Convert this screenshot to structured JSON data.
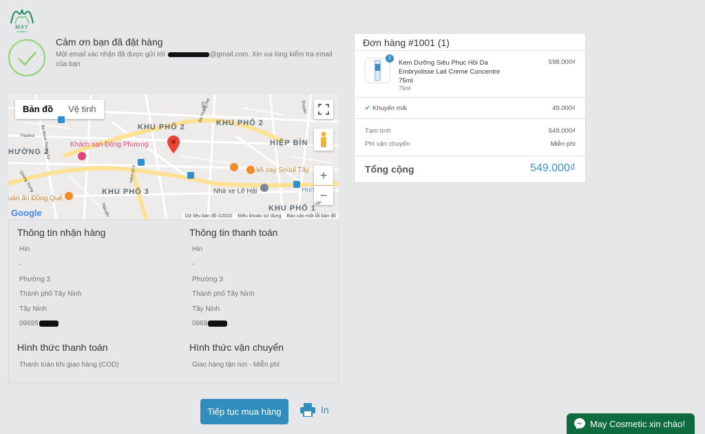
{
  "logo": {
    "brand": "MAY",
    "sub": "COSMETIC"
  },
  "thanks": {
    "title": "Cảm ơn bạn đã đặt hàng",
    "text_before": "Một email xác nhận đã được gửi tới ",
    "text_after": "@gmail.com. Xin vui lòng kiểm tra email của bạn"
  },
  "map": {
    "tabs": [
      "Bản đồ",
      "Vệ tinh"
    ],
    "areas": [
      "KHU PHỐ 2",
      "KHU PHỐ 2",
      "KHU PHỐ 3",
      "KHU PHỐ 1",
      "HIỆP BÌN",
      "HƯỜNG 2"
    ],
    "places": {
      "hotel": "Khách sạn Đông Phương",
      "noodle": "Mì cay Seoul Tây",
      "garage": "Nhà xe Lê Hải",
      "restaurant": "uán ăn Đồng Quê",
      "hon": "Hon"
    },
    "streets": [
      "Ba Mươi Tháng Tư",
      "Ba Tháng Hai",
      "Pasteur",
      "Quang Trung",
      "Hẻm số 0",
      "Nguyễn",
      "Thuyền",
      "Vân",
      "Trần"
    ],
    "footer": [
      "Dữ liệu bản đồ ©2020",
      "Điều khoản sử dụng",
      "Báo cáo một lỗi bản đồ"
    ],
    "google": "Google",
    "zoom_in": "+",
    "zoom_out": "−"
  },
  "shipping_info": {
    "title": "Thông tin nhận hàng",
    "name": "Hin",
    "address": "-",
    "ward": "Phường 3",
    "city": "Thành phố Tây Ninh",
    "province": "Tây Ninh",
    "phone_prefix": "09695"
  },
  "billing_info": {
    "title": "Thông tin thanh toán",
    "name": "Hin",
    "address": "-",
    "ward": "Phường 3",
    "city": "Thành phố Tây Ninh",
    "province": "Tây Ninh",
    "phone_prefix": "0969"
  },
  "payment_method": {
    "title": "Hình thức thanh toán",
    "value": "Thanh toán khi giao hàng (COD)"
  },
  "shipping_method": {
    "title": "Hình thức vận chuyển",
    "value": "Giao hàng tận nơi - Miễn phí"
  },
  "actions": {
    "continue": "Tiếp tục mua hàng",
    "print": "In"
  },
  "order": {
    "title": "Đơn hàng #1001 (1)",
    "product": {
      "name": "Kem Dưỡng Siêu Phục Hồi Da Embryolisse Lait Creme Concentre 75ml",
      "variant": "75ml",
      "price": "598.000₫",
      "quantity": "1"
    },
    "discount_label": "Khuyến mãi",
    "discount_value": "49.000₫",
    "subtotal_label": "Tạm tính",
    "subtotal_value": "549.000₫",
    "shipping_label": "Phí vận chuyển",
    "shipping_value": "Miễn phí",
    "total_label": "Tổng cộng",
    "total_value": "549.000₫"
  },
  "chat": {
    "label": "May Cosmetic xin chào!"
  },
  "colors": {
    "accent": "#338dbc",
    "success": "#8fd16a",
    "chat": "#0d6b3e",
    "total": "#3a8fc8"
  }
}
